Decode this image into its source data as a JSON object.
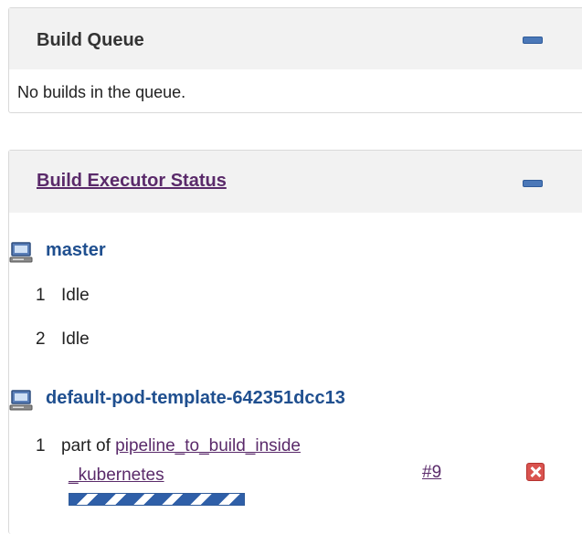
{
  "build_queue": {
    "title": "Build Queue",
    "empty_message": "No builds in the queue."
  },
  "executor_status": {
    "title": "Build Executor Status",
    "nodes": [
      {
        "name": "master",
        "executors": [
          {
            "number": "1",
            "status": "Idle"
          },
          {
            "number": "2",
            "status": "Idle"
          }
        ]
      },
      {
        "name": "default-pod-template-642351dcc13",
        "executors": [
          {
            "number": "1",
            "prefix": "part of",
            "job_line1": "pipeline_to_build_inside",
            "job_line2": "_kubernetes",
            "build_number": "#9",
            "progress_state": "indeterminate"
          }
        ]
      }
    ]
  },
  "colors": {
    "accent_blue": "#1f4f8f",
    "visited_link": "#5a2a6a",
    "stop_red": "#d9534f",
    "header_bg": "#f2f2f2"
  }
}
